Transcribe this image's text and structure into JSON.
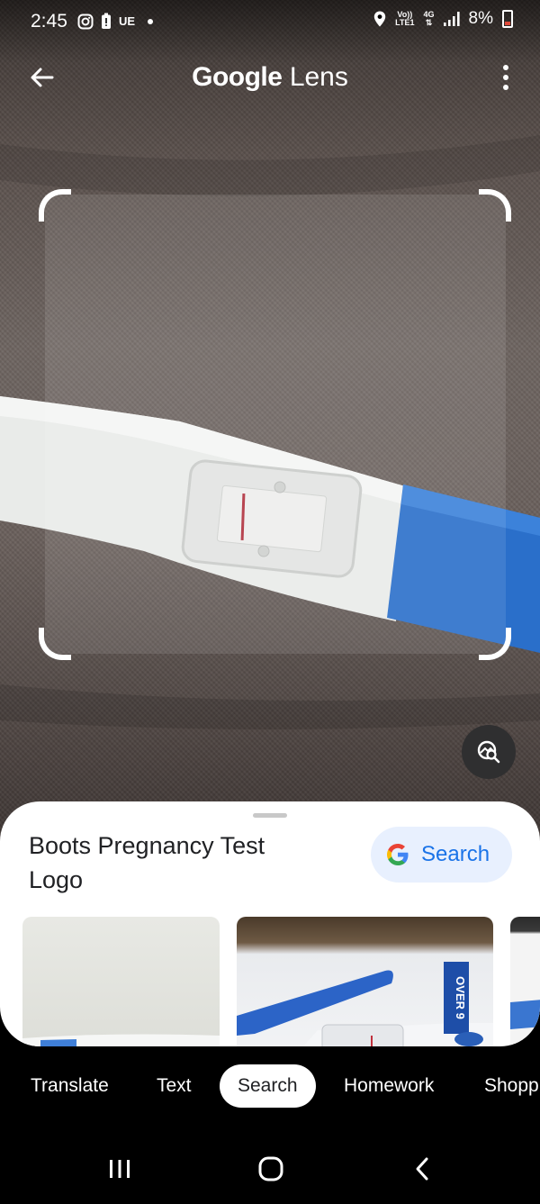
{
  "status_bar": {
    "time": "2:45",
    "left_icons": [
      "instagram-icon",
      "battery-saver-icon"
    ],
    "carrier_badge": "UE",
    "network_line1": "Vo))",
    "network_line2": "LTE1",
    "network_type": "4G",
    "battery": "8%"
  },
  "header": {
    "title_brand": "Google",
    "title_product": "Lens"
  },
  "result": {
    "title": "Boots Pregnancy Test Logo",
    "search_button": "Search"
  },
  "thumbnails": [
    {
      "label": ""
    },
    {
      "label": "OVER 9"
    },
    {
      "label": ""
    }
  ],
  "modes": {
    "items": [
      "Translate",
      "Text",
      "Search",
      "Homework",
      "Shopp"
    ],
    "selected": "Search"
  },
  "colors": {
    "accent_blue": "#1a73e8",
    "pill_bg": "#e8f0fe",
    "test_blue": "#2a6fca"
  }
}
